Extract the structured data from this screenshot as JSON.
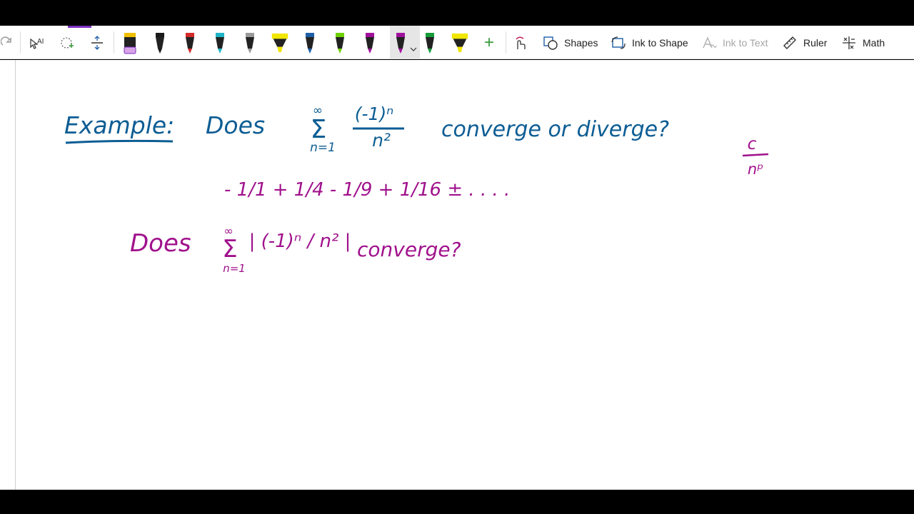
{
  "toolbar": {
    "shapes_label": "Shapes",
    "ink_to_shape_label": "Ink to Shape",
    "ink_to_text_label": "Ink to Text",
    "ruler_label": "Ruler",
    "math_label": "Math",
    "add_pen_symbol": "+",
    "pens": [
      {
        "name": "pen-1",
        "color": "#d9a3e8",
        "kind": "highlighter"
      },
      {
        "name": "pen-2",
        "color": "#1a1a1a",
        "kind": "pen"
      },
      {
        "name": "pen-3",
        "color": "#d42a2a",
        "kind": "pen"
      },
      {
        "name": "pen-4",
        "color": "#1fb5c9",
        "kind": "pen"
      },
      {
        "name": "pen-5",
        "color": "#9a9a9a",
        "kind": "pen"
      },
      {
        "name": "pen-6",
        "color": "#f0e600",
        "kind": "highlighter"
      },
      {
        "name": "pen-7",
        "color": "#1f5fa8",
        "kind": "pen"
      },
      {
        "name": "pen-8",
        "color": "#6fd100",
        "kind": "pen"
      },
      {
        "name": "pen-9",
        "color": "#a0119c",
        "kind": "pen"
      },
      {
        "name": "pen-10",
        "color": "#a0119c",
        "kind": "pen",
        "selected": true
      },
      {
        "name": "pen-11",
        "color": "#169c3a",
        "kind": "pen"
      },
      {
        "name": "pen-12",
        "color": "#f0e600",
        "kind": "highlighter"
      }
    ]
  },
  "ink": {
    "blue_color": "#0d5d94",
    "magenta_color": "#a0118c",
    "example_label": "Example:",
    "does_1": "Does",
    "sum_symbol": "Σ",
    "infinity": "∞",
    "index": "n=1",
    "numerator": "(-1)ⁿ",
    "denominator": "n²",
    "converge_or_diverge": "converge or diverge?",
    "side_fraction_num": "c",
    "side_fraction_den": "nᵖ",
    "series_terms": "- 1/1 + 1/4 - 1/9 + 1/16 ± . . . .",
    "does_2": "Does",
    "abs_term": "| (-1)ⁿ / n² |",
    "converge_q": "converge?"
  }
}
